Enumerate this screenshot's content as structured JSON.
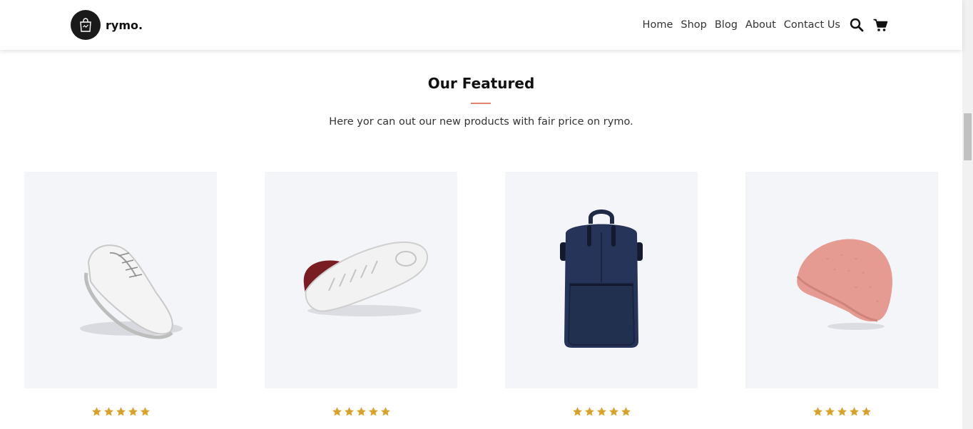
{
  "brand": {
    "name": "rymo."
  },
  "nav": {
    "items": [
      "Home",
      "Shop",
      "Blog",
      "About",
      "Contact Us"
    ],
    "icons": [
      "search-icon",
      "cart-icon"
    ]
  },
  "featured": {
    "title": "Our Featured",
    "subtitle": "Here yor can out our new products with fair price on rymo."
  },
  "products": [
    {
      "image": "white-sneaker",
      "rating": 5
    },
    {
      "image": "maroon-sneaker",
      "rating": 5
    },
    {
      "image": "navy-backpack",
      "rating": 5
    },
    {
      "image": "pink-beanie",
      "rating": 5
    }
  ],
  "colors": {
    "accent_line": "#e0856a",
    "star": "#d9a02a",
    "card_bg": "#f4f5f8"
  }
}
